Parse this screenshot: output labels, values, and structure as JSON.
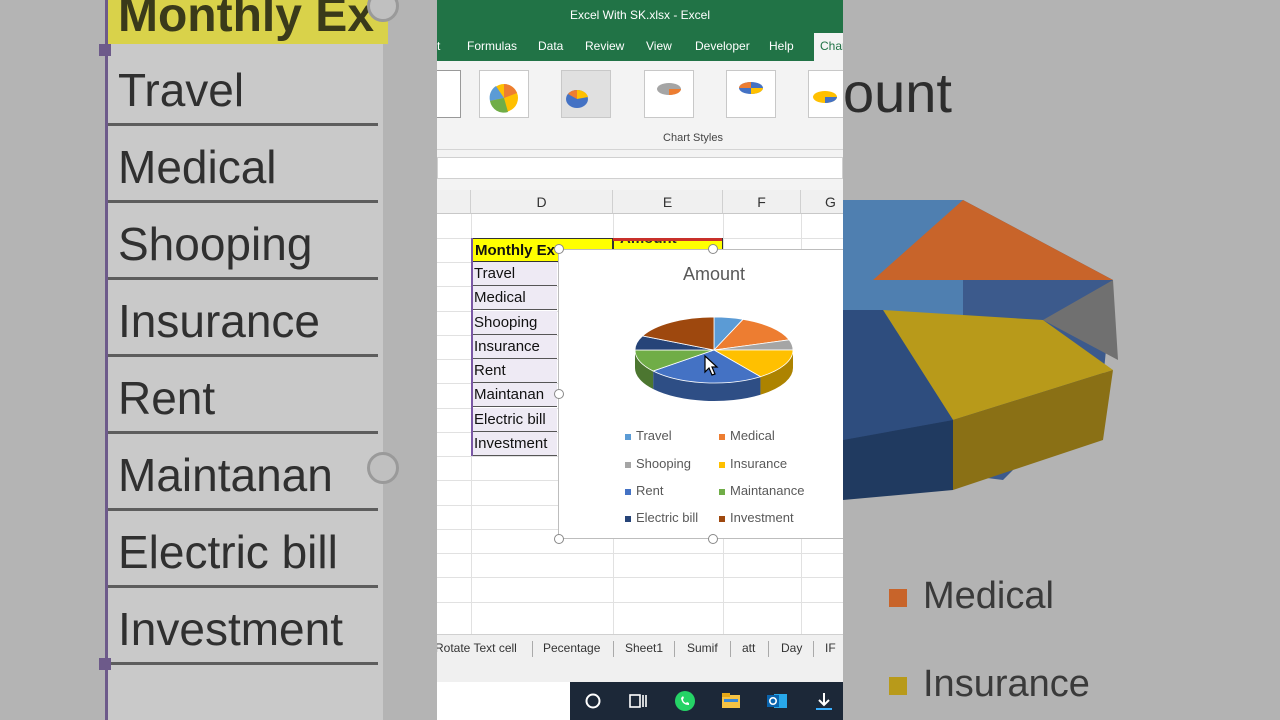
{
  "window": {
    "title": "Excel With SK.xlsx  -  Excel"
  },
  "ribbon_tabs": [
    "t",
    "Formulas",
    "Data",
    "Review",
    "View",
    "Developer",
    "Help",
    "Chart Design"
  ],
  "ribbon_tab_visible": [
    "t",
    "Formulas",
    "Data",
    "Review",
    "View",
    "Developer",
    "Help",
    "Char"
  ],
  "ribbon_group_label": "Chart Styles",
  "columns": [
    "D",
    "E",
    "F",
    "G"
  ],
  "cells": {
    "header": "Monthly Ex",
    "header_e": "Amount",
    "items": [
      "Travel",
      "Medical",
      "Shooping",
      "Insurance",
      "Rent",
      "Maintanance",
      "Electric bill",
      "Investment"
    ],
    "items_visible": [
      "Travel",
      "Medical",
      "Shooping",
      "Insurance",
      "Rent",
      "Maintanan",
      "Electric bill",
      "Investment"
    ]
  },
  "chart": {
    "title": "Amount",
    "legend": [
      "Travel",
      "Medical",
      "Shooping",
      "Insurance",
      "Rent",
      "Maintanance",
      "Electric bill",
      "Investment"
    ],
    "colors": [
      "#5b9bd5",
      "#ed7d31",
      "#a5a5a5",
      "#ffc000",
      "#4472c4",
      "#70ad47",
      "#264478",
      "#9e480e"
    ]
  },
  "chart_data": {
    "type": "pie",
    "title": "Amount",
    "categories": [
      "Travel",
      "Medical",
      "Shooping",
      "Insurance",
      "Rent",
      "Maintanance",
      "Electric bill",
      "Investment"
    ],
    "values": [
      6,
      14,
      5,
      15,
      24,
      11,
      7,
      18
    ],
    "legend_position": "bottom"
  },
  "sheet_tabs": [
    "Rotate Text cell",
    "Pecentage",
    "Sheet1",
    "Sumif",
    "att",
    "Day",
    "IF"
  ],
  "background": {
    "left_header": "Monthly Ex",
    "left_items": [
      "Travel",
      "Medical",
      "Shooping",
      "Insurance",
      "Rent",
      "Maintanan",
      "Electric bill",
      "Investment"
    ],
    "right_title": "ount",
    "right_legend": [
      "Medical",
      "Insurance"
    ]
  },
  "taskbar_icons": [
    "cortana-icon",
    "task-view-icon",
    "whatsapp-icon",
    "file-explorer-icon",
    "outlook-icon",
    "download-icon"
  ]
}
